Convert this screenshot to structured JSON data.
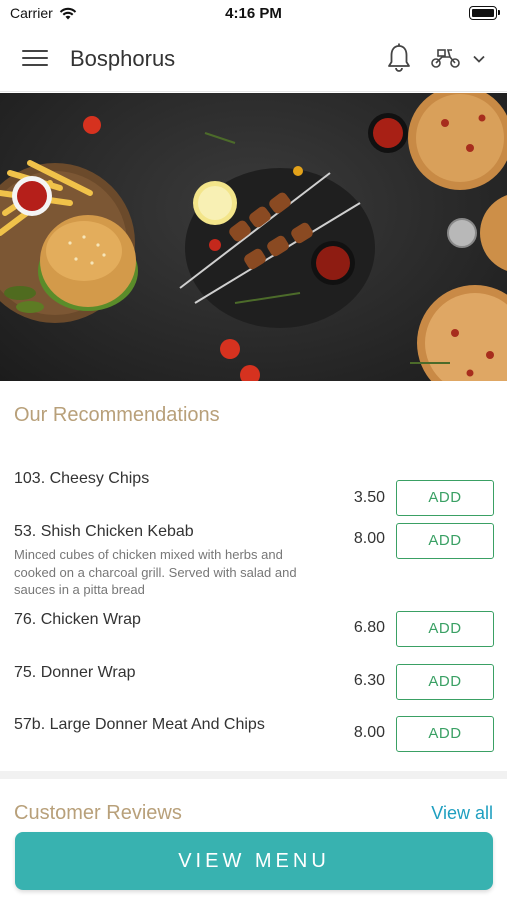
{
  "status_bar": {
    "carrier": "Carrier",
    "time": "4:16 PM"
  },
  "header": {
    "title": "Bosphorus",
    "menu_icon": "hamburger-menu-icon",
    "notification_icon": "bell-icon",
    "delivery_icon": "scooter-icon",
    "dropdown_icon": "chevron-down-icon"
  },
  "recommendations": {
    "title": "Our Recommendations",
    "add_label": "ADD",
    "items": [
      {
        "name": "103. Cheesy Chips",
        "description": "",
        "price": "3.50"
      },
      {
        "name": "53. Shish Chicken Kebab",
        "description": "Minced cubes of chicken mixed with herbs and cooked on a charcoal grill. Served with salad and sauces in a pitta bread",
        "price": "8.00"
      },
      {
        "name": "76. Chicken Wrap",
        "description": "",
        "price": "6.80"
      },
      {
        "name": "75. Donner Wrap",
        "description": "",
        "price": "6.30"
      },
      {
        "name": "57b. Large Donner Meat And Chips",
        "description": "",
        "price": "8.00"
      }
    ]
  },
  "reviews": {
    "title": "Customer Reviews",
    "view_all": "View all"
  },
  "cta": {
    "label": "VIEW MENU"
  },
  "colors": {
    "accent_teal": "#38b2b0",
    "add_green": "#3aa064",
    "section_title": "#b8a07a",
    "link_blue": "#1f9fc0"
  }
}
